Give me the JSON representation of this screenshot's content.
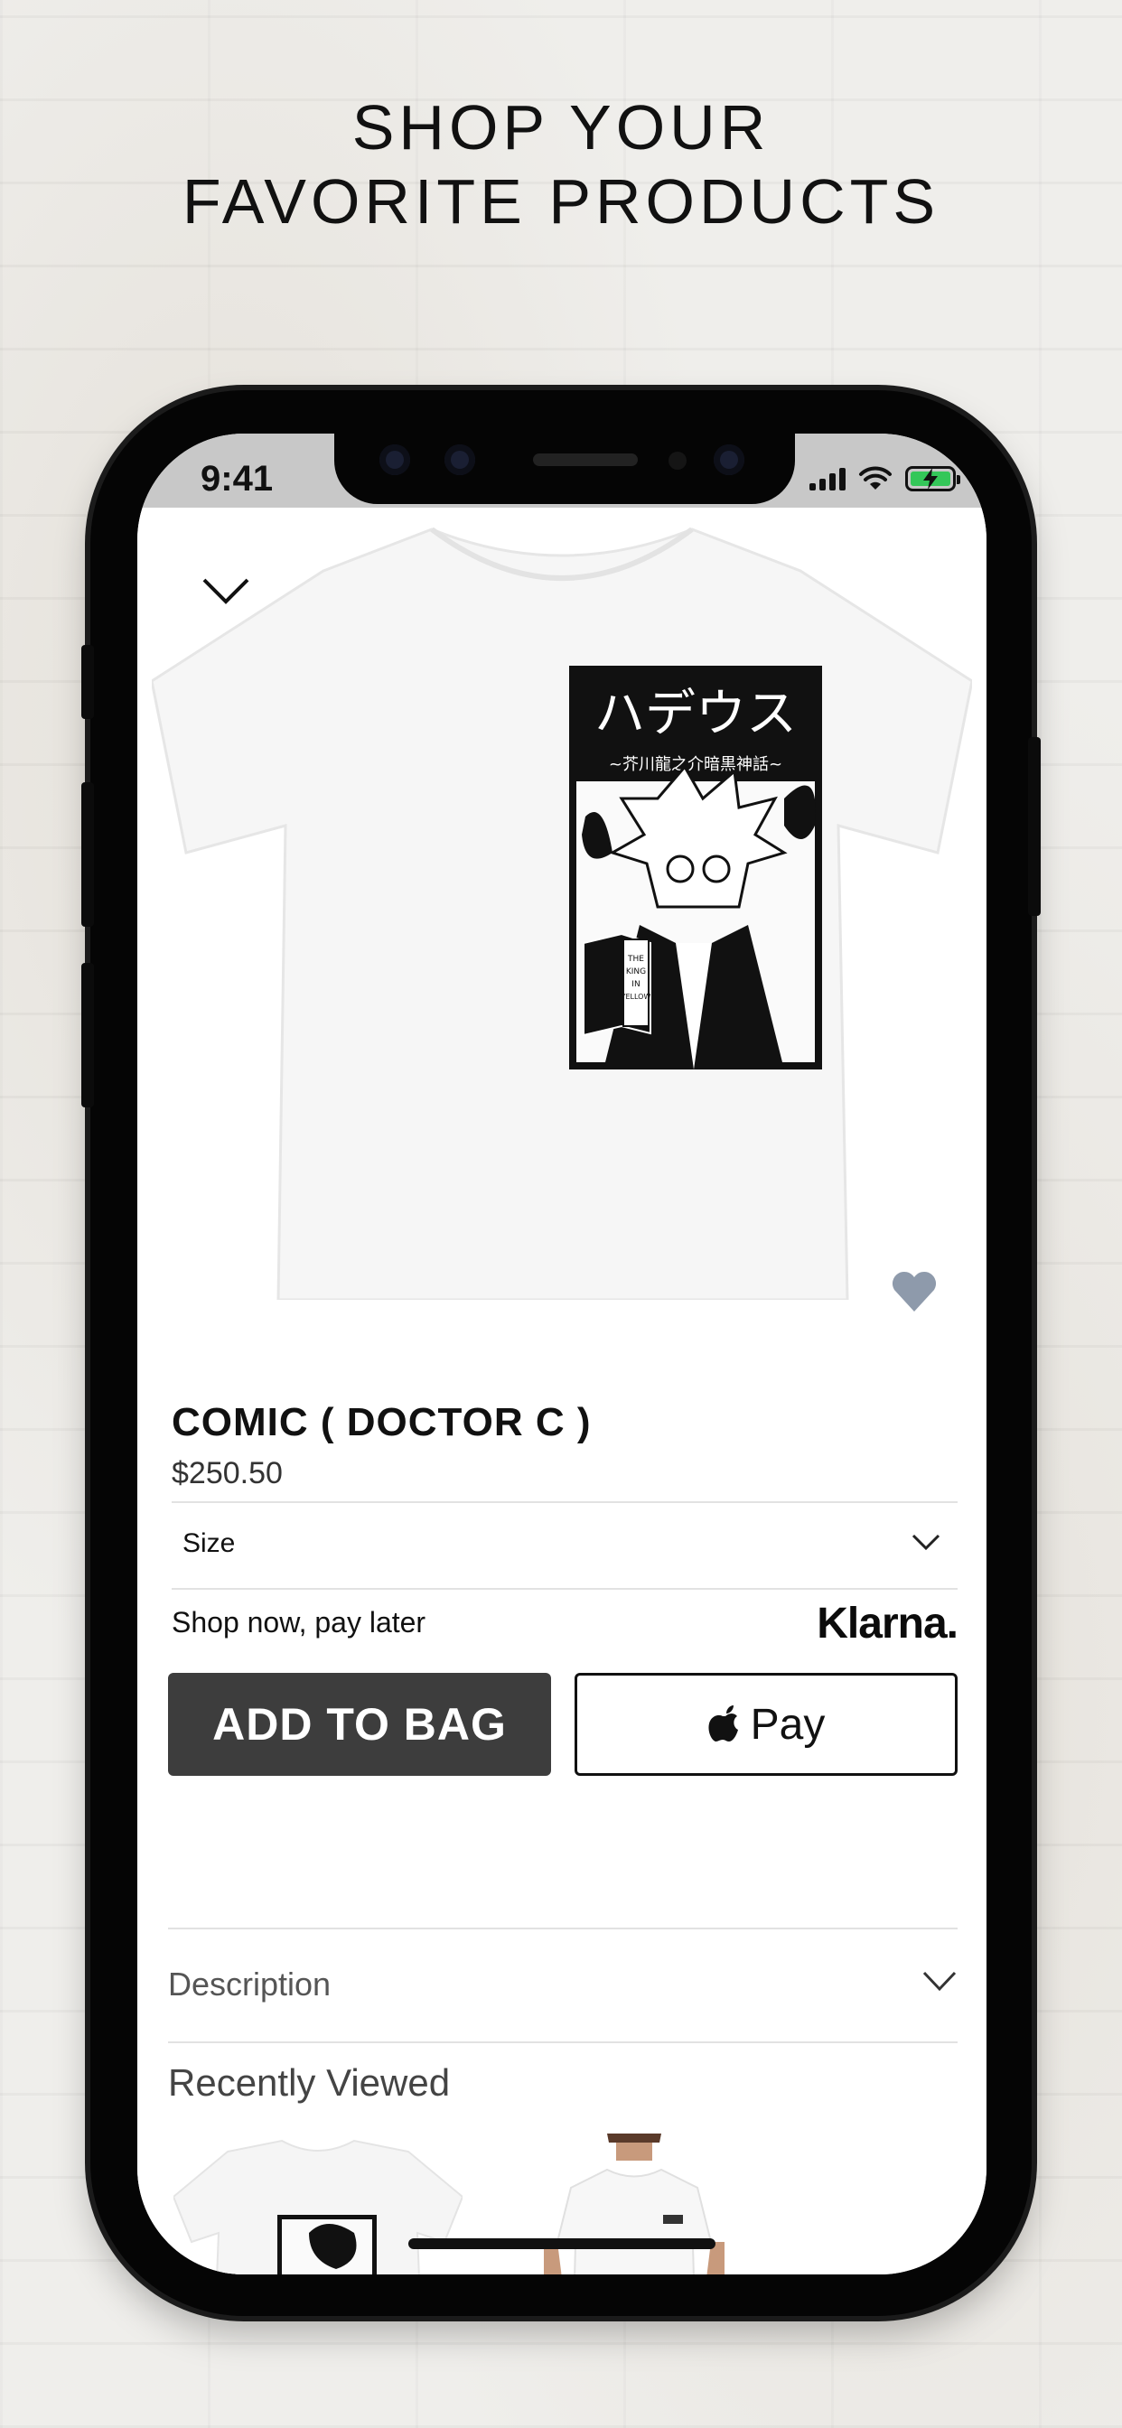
{
  "headline": {
    "line1": "SHOP YOUR",
    "line2": "FAVORITE PRODUCTS"
  },
  "status_bar": {
    "time": "9:41",
    "icons": [
      "signal-icon",
      "wifi-icon",
      "battery-charging-icon"
    ],
    "battery_color": "#34c759"
  },
  "product": {
    "name": "COMIC ( DOCTOR C )",
    "price": "$250.50",
    "image_title_jp": "ハデウス",
    "image_subtitle_jp": "~芥川龍之介暗黒神話~",
    "book_text_1": "THE",
    "book_text_2": "KING",
    "book_text_3": "IN",
    "book_text_4": "YELLOW",
    "favorite_color": "#8e9aab"
  },
  "size_selector": {
    "label": "Size"
  },
  "klarna": {
    "text": "Shop now, pay later",
    "logo": "Klarna."
  },
  "buttons": {
    "add_to_bag": "ADD TO BAG",
    "apple_pay": "Pay"
  },
  "description": {
    "label": "Description"
  },
  "recently_viewed": {
    "title": "Recently Viewed"
  },
  "colors": {
    "button_dark": "#3d3d3d",
    "status_bar_bg": "#c8c8c8"
  }
}
